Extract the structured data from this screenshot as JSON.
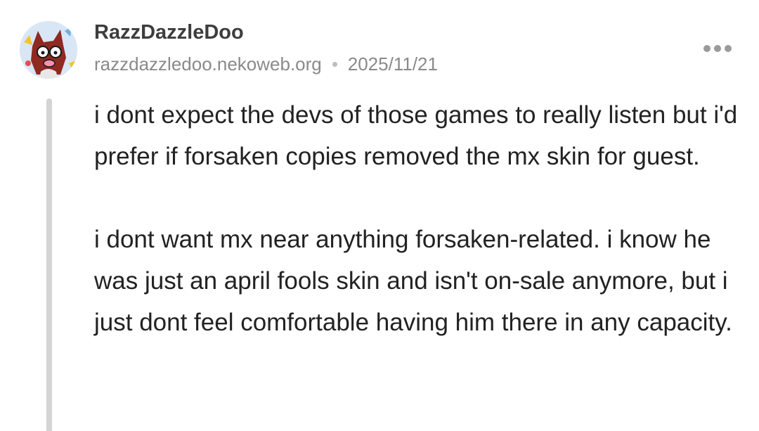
{
  "post": {
    "author": {
      "display_name": "RazzDazzleDoo",
      "site": "razzdazzledoo.nekoweb.org"
    },
    "date": "2025/11/21",
    "menu_icon": "more-horizontal-icon",
    "paragraphs": [
      "i dont expect the devs of those games to really listen but i'd prefer if forsaken copies removed the mx skin for guest.",
      "i dont want mx near anything forsaken-related. i know he was just an april fools skin and isn't on-sale anymore, but i just dont feel comfortable having him there in any capacity."
    ]
  },
  "colors": {
    "name": "#3d3d3d",
    "meta": "#8a8a8a",
    "body_text": "#222222",
    "thread_line": "#d4d4d4"
  }
}
